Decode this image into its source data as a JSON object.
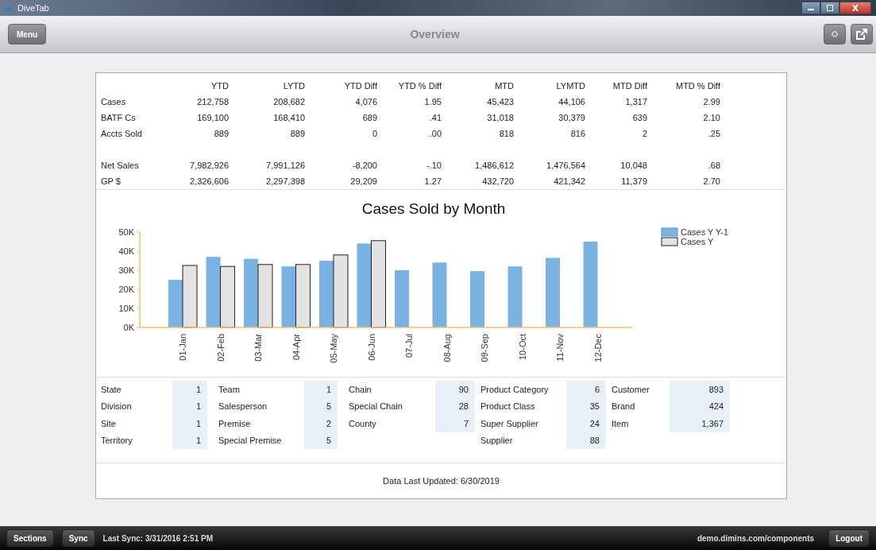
{
  "window": {
    "title": "DiveTab"
  },
  "toolbar": {
    "menu": "Menu",
    "title": "Overview"
  },
  "summary": {
    "columns": [
      "YTD",
      "LYTD",
      "YTD Diff",
      "YTD % Diff",
      "MTD",
      "LYMTD",
      "MTD Diff",
      "MTD % Diff"
    ],
    "groups": [
      [
        {
          "label": "Cases",
          "values": [
            "212,758",
            "208,682",
            "4,076",
            "1.95",
            "45,423",
            "44,106",
            "1,317",
            "2.99"
          ]
        },
        {
          "label": "BATF Cs",
          "values": [
            "169,100",
            "168,410",
            "689",
            ".41",
            "31,018",
            "30,379",
            "639",
            "2.10"
          ]
        },
        {
          "label": "Accts Sold",
          "values": [
            "889",
            "889",
            "0",
            ".00",
            "818",
            "816",
            "2",
            ".25"
          ]
        }
      ],
      [
        {
          "label": "Net Sales",
          "values": [
            "7,982,926",
            "7,991,126",
            "-8,200",
            "-.10",
            "1,486,612",
            "1,476,564",
            "10,048",
            ".68"
          ]
        },
        {
          "label": "GP $",
          "values": [
            "2,326,606",
            "2,297,398",
            "29,209",
            "1.27",
            "432,720",
            "421,342",
            "11,379",
            "2.70"
          ]
        }
      ]
    ]
  },
  "chart_data": {
    "type": "bar",
    "title": "Cases Sold by Month",
    "categories": [
      "01-Jan",
      "02-Feb",
      "03-Mar",
      "04-Apr",
      "05-May",
      "06-Jun",
      "07-Jul",
      "08-Aug",
      "09-Sep",
      "10-Oct",
      "11-Nov",
      "12-Dec"
    ],
    "series": [
      {
        "name": "Cases Y Y-1",
        "color": "#7ab2e2",
        "values": [
          25000,
          37000,
          36000,
          32000,
          35000,
          44000,
          30000,
          34000,
          29500,
          32000,
          36500,
          45000
        ]
      },
      {
        "name": "Cases Y",
        "color": "#e2e2e2",
        "values": [
          32500,
          32000,
          33000,
          33000,
          38000,
          45500,
          null,
          null,
          null,
          null,
          null,
          null
        ]
      }
    ],
    "legend": "right",
    "ylim": [
      0,
      50000
    ],
    "yticks": [
      {
        "value": 0,
        "label": "0K"
      },
      {
        "value": 10000,
        "label": "10K"
      },
      {
        "value": 20000,
        "label": "20K"
      },
      {
        "value": 30000,
        "label": "30K"
      },
      {
        "value": 40000,
        "label": "40K"
      },
      {
        "value": 50000,
        "label": "50K"
      }
    ]
  },
  "counts": [
    [
      {
        "label": "State",
        "value": "1"
      },
      {
        "label": "Division",
        "value": "1"
      },
      {
        "label": "Site",
        "value": "1"
      },
      {
        "label": "Territory",
        "value": "1"
      }
    ],
    [
      {
        "label": "Team",
        "value": "1"
      },
      {
        "label": "Salesperson",
        "value": "5"
      },
      {
        "label": "Premise",
        "value": "2"
      },
      {
        "label": "Special Premise",
        "value": "5"
      }
    ],
    [
      {
        "label": "Chain",
        "value": "90"
      },
      {
        "label": "Special Chain",
        "value": "28"
      },
      {
        "label": "County",
        "value": "7"
      }
    ],
    [
      {
        "label": "Product Category",
        "value": "6"
      },
      {
        "label": "Product Class",
        "value": "35"
      },
      {
        "label": "Super Supplier",
        "value": "24"
      },
      {
        "label": "Supplier",
        "value": "88"
      }
    ],
    [
      {
        "label": "Customer",
        "value": "893"
      },
      {
        "label": "Brand",
        "value": "424"
      },
      {
        "label": "Item",
        "value": "1,367"
      }
    ]
  ],
  "updated": "Data Last Updated: 6/30/2019",
  "footer": {
    "sections": "Sections",
    "sync": "Sync",
    "last_sync": "Last Sync: 3/31/2016 2:51 PM",
    "url": "demo.dimins.com/components",
    "logout": "Logout"
  }
}
